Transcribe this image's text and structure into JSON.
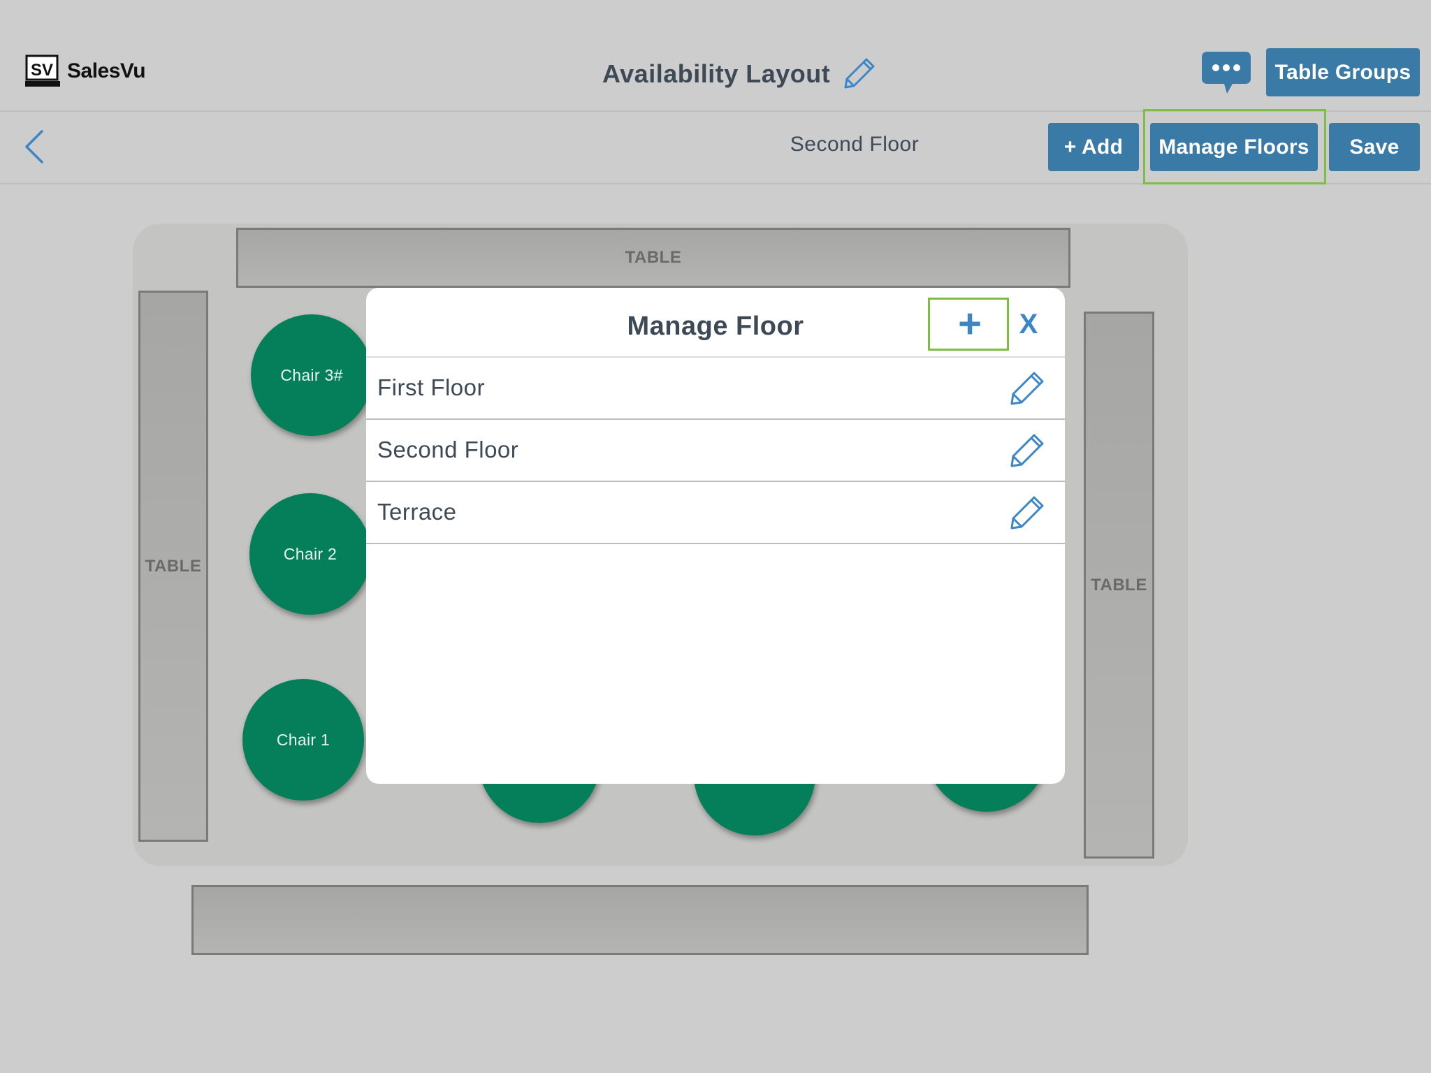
{
  "app": {
    "brand": "SalesVu",
    "logo_mark": "SV"
  },
  "header": {
    "title": "Availability Layout",
    "table_groups_label": "Table Groups"
  },
  "toolbar": {
    "current_floor": "Second Floor",
    "add_label": "+ Add",
    "manage_floors_label": "Manage Floors",
    "save_label": "Save"
  },
  "layout": {
    "tables": [
      "TABLE",
      "TABLE",
      "TABLE",
      ""
    ],
    "chairs": [
      "Chair 3#",
      "Chair 2",
      "Chair 1",
      "",
      "",
      ""
    ]
  },
  "modal": {
    "title": "Manage Floor",
    "add_symbol": "+",
    "close_symbol": "X",
    "floors": [
      {
        "name": "First Floor"
      },
      {
        "name": "Second Floor"
      },
      {
        "name": "Terrace"
      }
    ]
  },
  "colors": {
    "accent": "#3a7aa6",
    "icon_blue": "#3a86c6",
    "chair_green": "#047f59",
    "highlight": "#7dbd42"
  },
  "icons": {
    "title_edit": "pencil-icon",
    "chat": "chat-bubble-icon",
    "back": "chevron-left-icon",
    "row_edit": "pencil-icon"
  }
}
